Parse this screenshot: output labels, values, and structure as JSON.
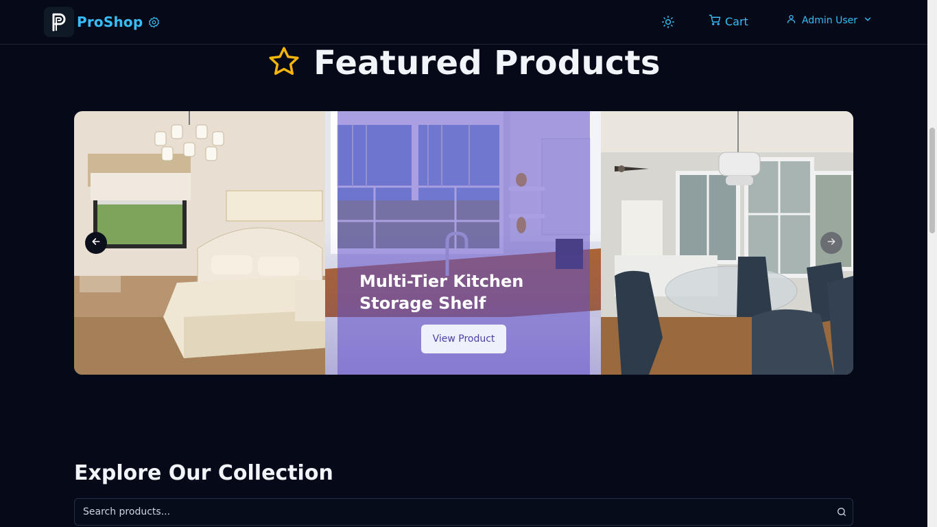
{
  "navbar": {
    "brand_name": "ProShop",
    "logo_letter_icon": "p-logo-icon",
    "badge_icon": "verified-badge-icon",
    "theme_icon": "sun-icon",
    "cart_label": "Cart",
    "cart_icon": "cart-icon",
    "user_label": "Admin User",
    "user_icon": "user-icon",
    "user_menu_icon": "chevron-down-icon"
  },
  "featured": {
    "heading": "Featured Products",
    "heading_icon": "star-icon",
    "carousel": {
      "active_title": "Multi-Tier Kitchen Storage Shelf",
      "view_button_label": "View Product",
      "prev_icon": "arrow-left-icon",
      "next_icon": "arrow-right-icon"
    }
  },
  "collection": {
    "heading": "Explore Our Collection",
    "search_placeholder": "Search products...",
    "search_value": "",
    "search_icon": "search-icon"
  },
  "colors": {
    "background": "#060a18",
    "accent": "#38bdf8",
    "star": "#f5b50a",
    "overlay": "#6250c8"
  }
}
